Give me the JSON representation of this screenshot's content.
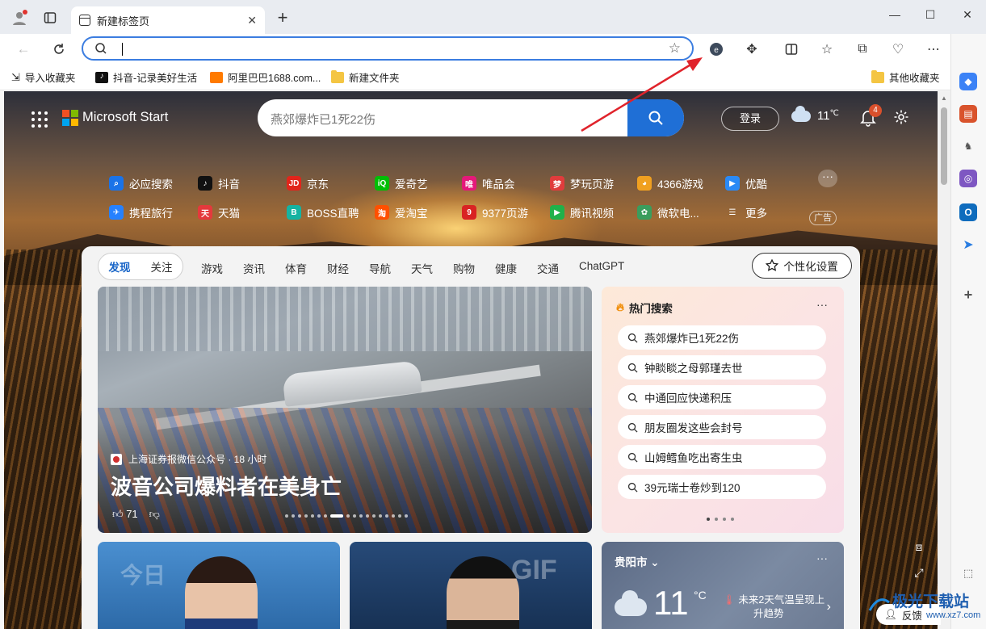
{
  "browser": {
    "tab_title": "新建标签页",
    "tab_close": "✕",
    "new_tab": "+",
    "address_value": "",
    "favorites": [
      {
        "label": "导入收藏夹"
      },
      {
        "label": "抖音-记录美好生活"
      },
      {
        "label": "阿里巴巴1688.com..."
      },
      {
        "label": "新建文件夹"
      }
    ],
    "other_favorites": "其他收藏夹",
    "colors": {
      "accent": "#3b7de0",
      "titlebar": "#e9ecf1"
    }
  },
  "ms": {
    "brand": "Microsoft Start",
    "search_placeholder": "燕郊爆炸已1死22伤",
    "login": "登录",
    "temp": "11",
    "temp_unit": "℃",
    "notifications": "4",
    "quick_links": [
      {
        "label": "必应搜索",
        "icon": "bing-icon",
        "color": "#1a73e8",
        "glyph": "⌕"
      },
      {
        "label": "抖音",
        "icon": "douyin-icon",
        "color": "#111111",
        "glyph": "♪"
      },
      {
        "label": "京东",
        "icon": "jd-icon",
        "color": "#e1251b",
        "glyph": "JD"
      },
      {
        "label": "爱奇艺",
        "icon": "iqiyi-icon",
        "color": "#00be06",
        "glyph": "iQ"
      },
      {
        "label": "唯品会",
        "icon": "vip-icon",
        "color": "#e4197a",
        "glyph": "唯"
      },
      {
        "label": "梦玩页游",
        "icon": "mengwan-icon",
        "color": "#e03c3c",
        "glyph": "梦"
      },
      {
        "label": "4366游戏",
        "icon": "4366-icon",
        "color": "#f0a020",
        "glyph": "◕"
      },
      {
        "label": "优酷",
        "icon": "youku-icon",
        "color": "#2a8af6",
        "glyph": "▶"
      },
      {
        "label": "携程旅行",
        "icon": "ctrip-icon",
        "color": "#2681ff",
        "glyph": "✈"
      },
      {
        "label": "天猫",
        "icon": "tmall-icon",
        "color": "#e4393c",
        "glyph": "天"
      },
      {
        "label": "BOSS直聘",
        "icon": "boss-icon",
        "color": "#15b3a2",
        "glyph": "B"
      },
      {
        "label": "爱淘宝",
        "icon": "aitaobao-icon",
        "color": "#ff5000",
        "glyph": "淘"
      },
      {
        "label": "9377页游",
        "icon": "9377-icon",
        "color": "#d92323",
        "glyph": "9"
      },
      {
        "label": "腾讯视频",
        "icon": "tencent-video-icon",
        "color": "#20b14a",
        "glyph": "▶"
      },
      {
        "label": "微软电...",
        "icon": "ms-store-icon",
        "color": "#3a9d5d",
        "glyph": "✿"
      },
      {
        "label": "更多",
        "icon": "more-icon",
        "color": "transparent",
        "glyph": "☰"
      }
    ],
    "ad_label": "广告"
  },
  "feed": {
    "tabs_primary": [
      "发现",
      "关注"
    ],
    "tabs": [
      "游戏",
      "资讯",
      "体育",
      "财经",
      "导航",
      "天气",
      "购物",
      "健康",
      "交通",
      "ChatGPT"
    ],
    "personalize": "个性化设置",
    "hero": {
      "source": "上海证券报微信公众号 · 18 小时",
      "title": "波音公司爆料者在美身亡",
      "likes": "71"
    },
    "trending_title": "热门搜索",
    "trending": [
      "燕郊爆炸已1死22伤",
      "钟睒睒之母郭瑾去世",
      "中通回应快递积压",
      "朋友圈发这些会封号",
      "山姆鳕鱼吃出寄生虫",
      "39元瑞士卷炒到120"
    ],
    "weather": {
      "city": "贵阳市",
      "temp": "11",
      "unit": "°C",
      "note_line1": "未来2天气温呈现上",
      "note_line2": "升趋势"
    },
    "gif_text": "GIF",
    "tv_text": "今日"
  },
  "feedback": "反馈",
  "watermark": {
    "title": "极光下载站",
    "sub": "www.xz7.com"
  }
}
